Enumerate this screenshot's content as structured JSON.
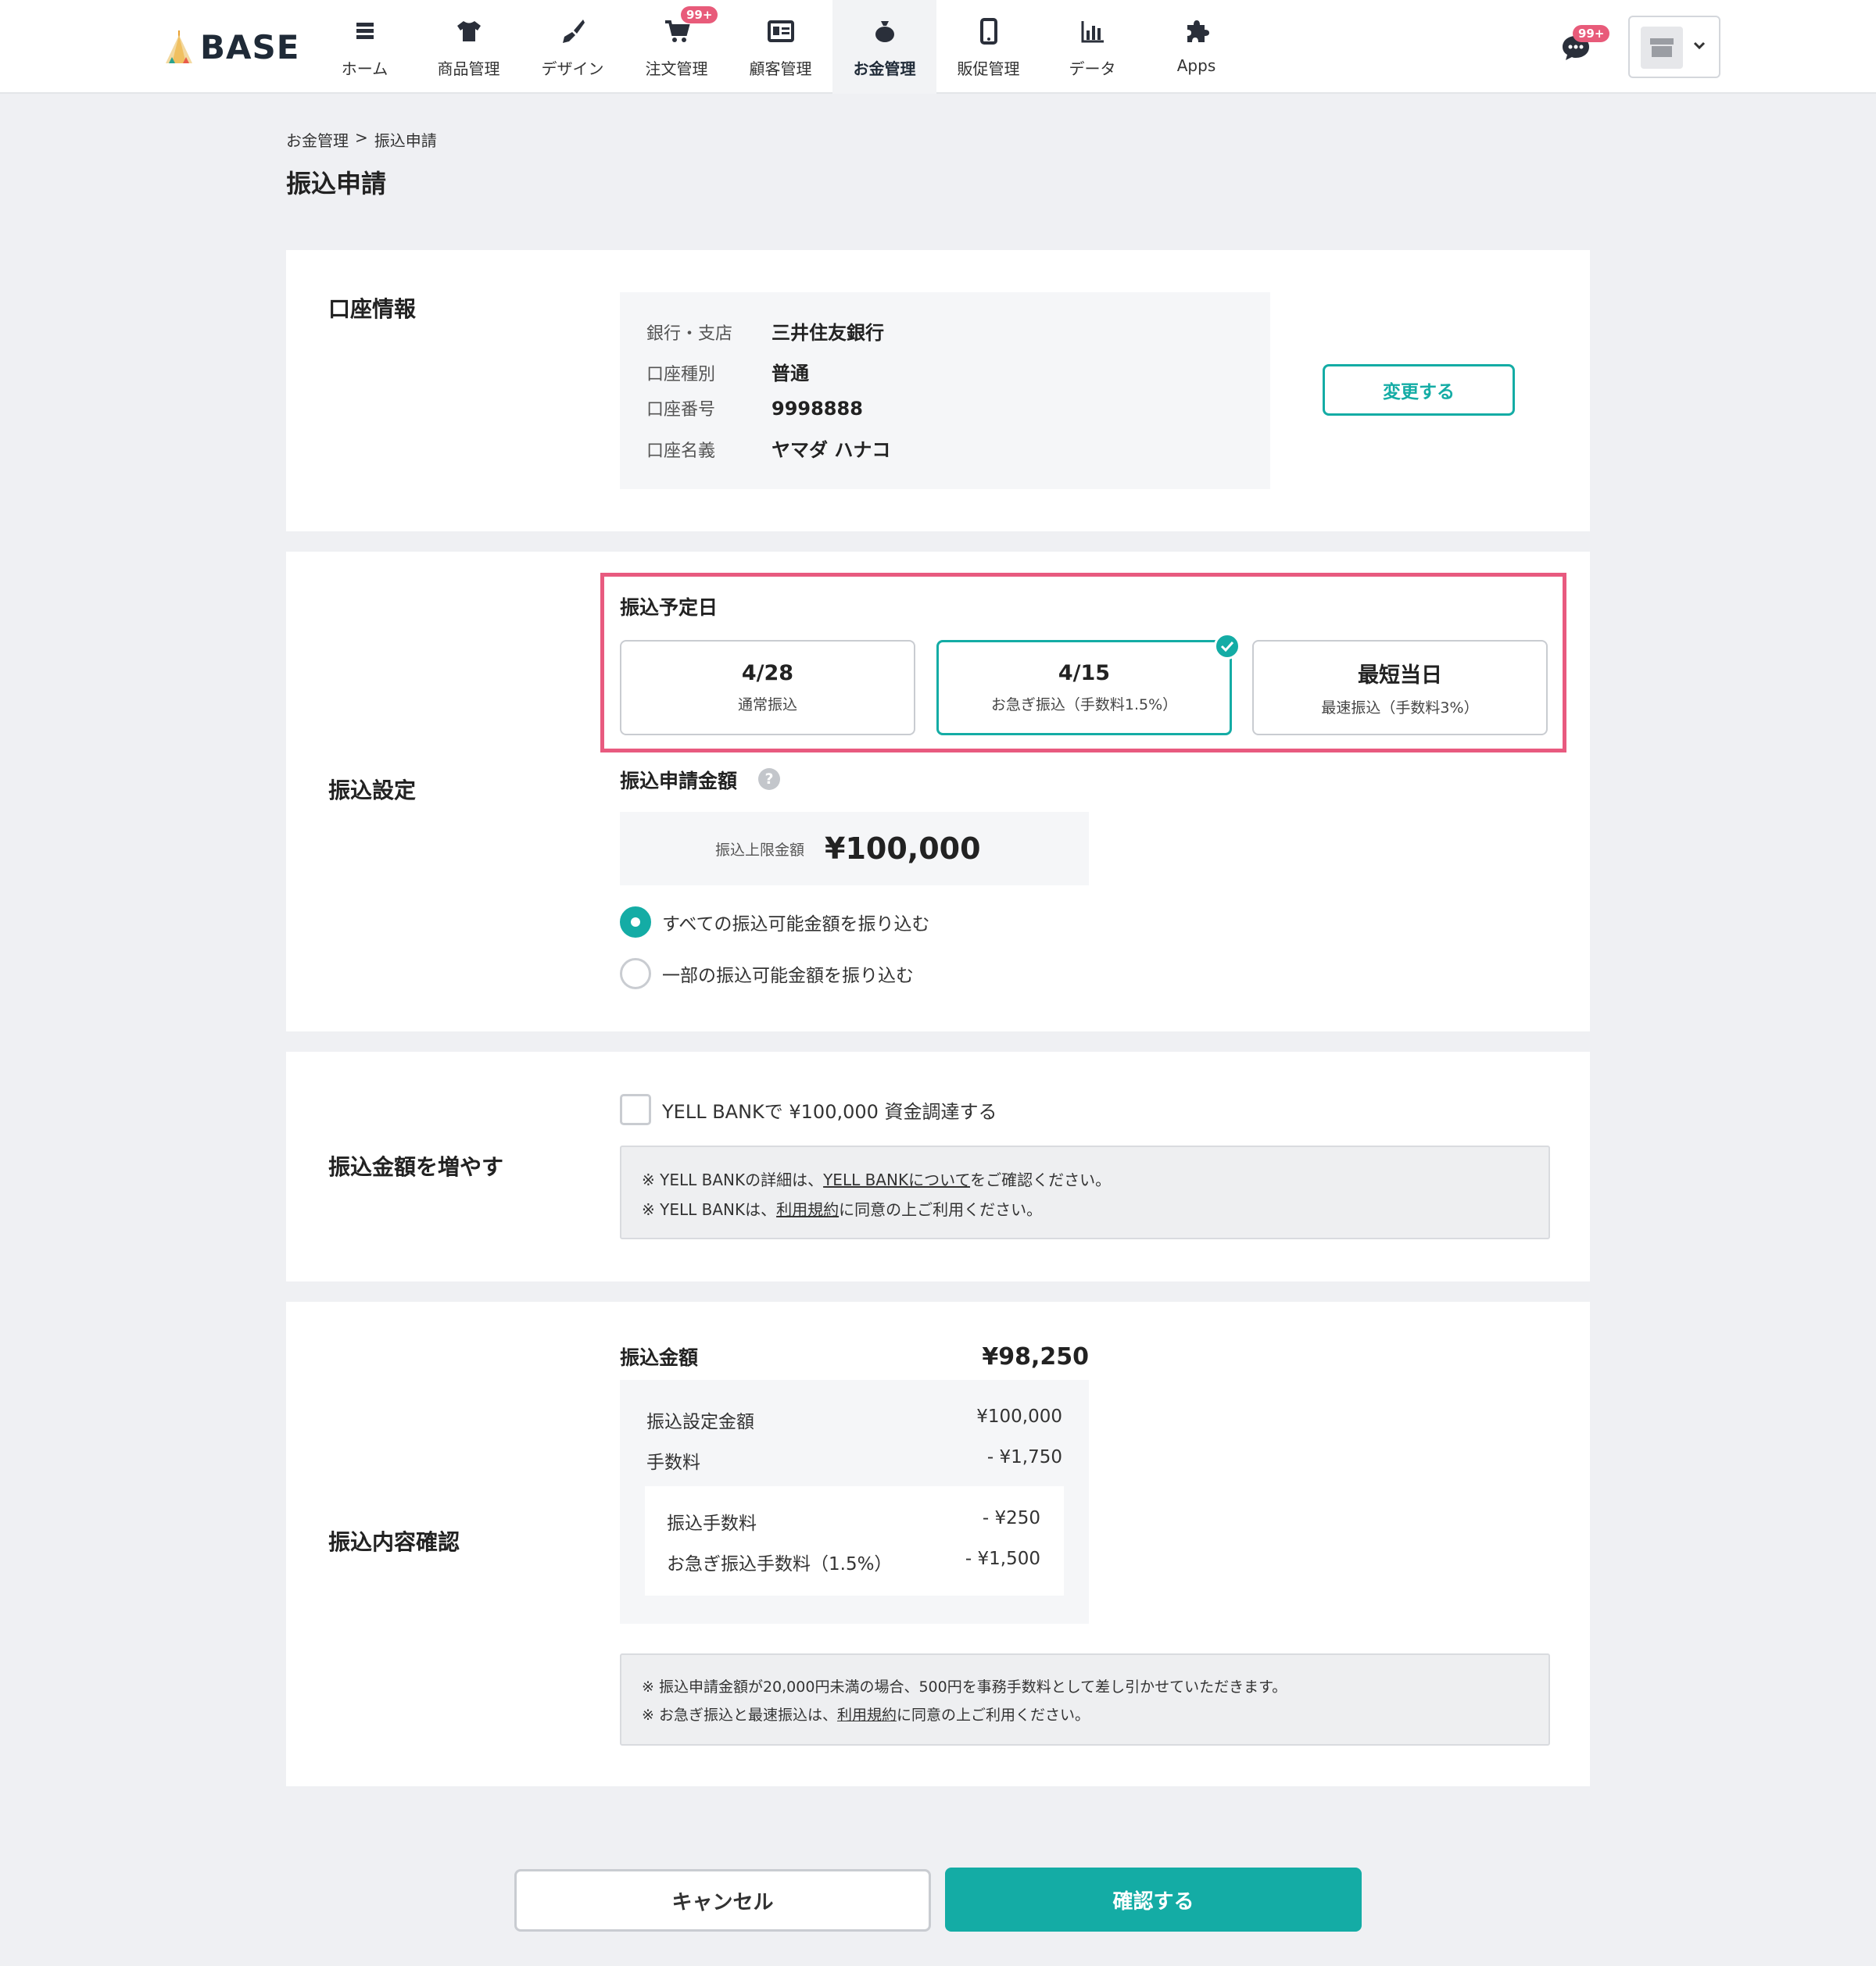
{
  "header": {
    "logo_text": "BASE",
    "nav": [
      {
        "label": "ホーム",
        "icon": "home-list-icon"
      },
      {
        "label": "商品管理",
        "icon": "tshirt-icon"
      },
      {
        "label": "デザイン",
        "icon": "brush-icon"
      },
      {
        "label": "注文管理",
        "icon": "cart-icon",
        "badge": "99+"
      },
      {
        "label": "顧客管理",
        "icon": "customer-card-icon"
      },
      {
        "label": "お金管理",
        "icon": "money-bag-icon",
        "active": true
      },
      {
        "label": "販促管理",
        "icon": "smartphone-icon"
      },
      {
        "label": "データ",
        "icon": "bar-chart-icon"
      },
      {
        "label": "Apps",
        "icon": "puzzle-icon"
      }
    ],
    "chat_badge": "99+"
  },
  "breadcrumb": {
    "parent": "お金管理",
    "separator": ">",
    "current": "振込申請"
  },
  "page_title": "振込申請",
  "account": {
    "title": "口座情報",
    "rows": [
      {
        "k": "銀行・支店",
        "v": "三井住友銀行"
      },
      {
        "k": "口座種別",
        "v": "普通"
      },
      {
        "k": "口座番号",
        "v": "9998888"
      },
      {
        "k": "口座名義",
        "v": "ヤマダ ハナコ"
      }
    ],
    "change_label": "変更する"
  },
  "transfer": {
    "title": "振込設定",
    "date_title": "振込予定日",
    "options": [
      {
        "main": "4/28",
        "sub": "通常振込"
      },
      {
        "main": "4/15",
        "sub": "お急ぎ振込（手数料1.5%）"
      },
      {
        "main": "最短当日",
        "sub": "最速振込（手数料3%）"
      }
    ],
    "amount_title": "振込申請金額",
    "help": "?",
    "limit_label": "振込上限金額",
    "limit_value": "¥100,000",
    "radio_all": "すべての振込可能金額を振り込む",
    "radio_part": "一部の振込可能金額を振り込む"
  },
  "increase": {
    "title": "振込金額を増やす",
    "checkbox_label": "YELL BANKで ¥100,000 資金調達する",
    "note1_a": "※ YELL BANKの詳細は、",
    "note1_link": "YELL BANKについて",
    "note1_b": "をご確認ください。",
    "note2_a": "※ YELL BANKは、",
    "note2_link": "利用規約",
    "note2_b": "に同意の上ご利用ください。"
  },
  "confirm": {
    "title": "振込内容確認",
    "total_label": "振込金額",
    "total_value": "¥98,250",
    "rows": [
      {
        "k": "振込設定金額",
        "v": "¥100,000"
      },
      {
        "k": "手数料",
        "v": "- ¥1,750"
      }
    ],
    "inner_rows": [
      {
        "k": "振込手数料",
        "v": "- ¥250"
      },
      {
        "k": "お急ぎ振込手数料（1.5%）",
        "v": "- ¥1,500"
      }
    ],
    "note1": "※ 振込申請金額が20,000円未満の場合、500円を事務手数料として差し引かせていただきます。",
    "note2_a": "※ お急ぎ振込と最速振込は、",
    "note2_link": "利用規約",
    "note2_b": "に同意の上ご利用ください。"
  },
  "footer": {
    "cancel_label": "キャンセル",
    "confirm_label": "確認する"
  },
  "colors": {
    "accent": "#14aca5",
    "highlight": "#e85a7f",
    "badge": "#e85b7a"
  }
}
